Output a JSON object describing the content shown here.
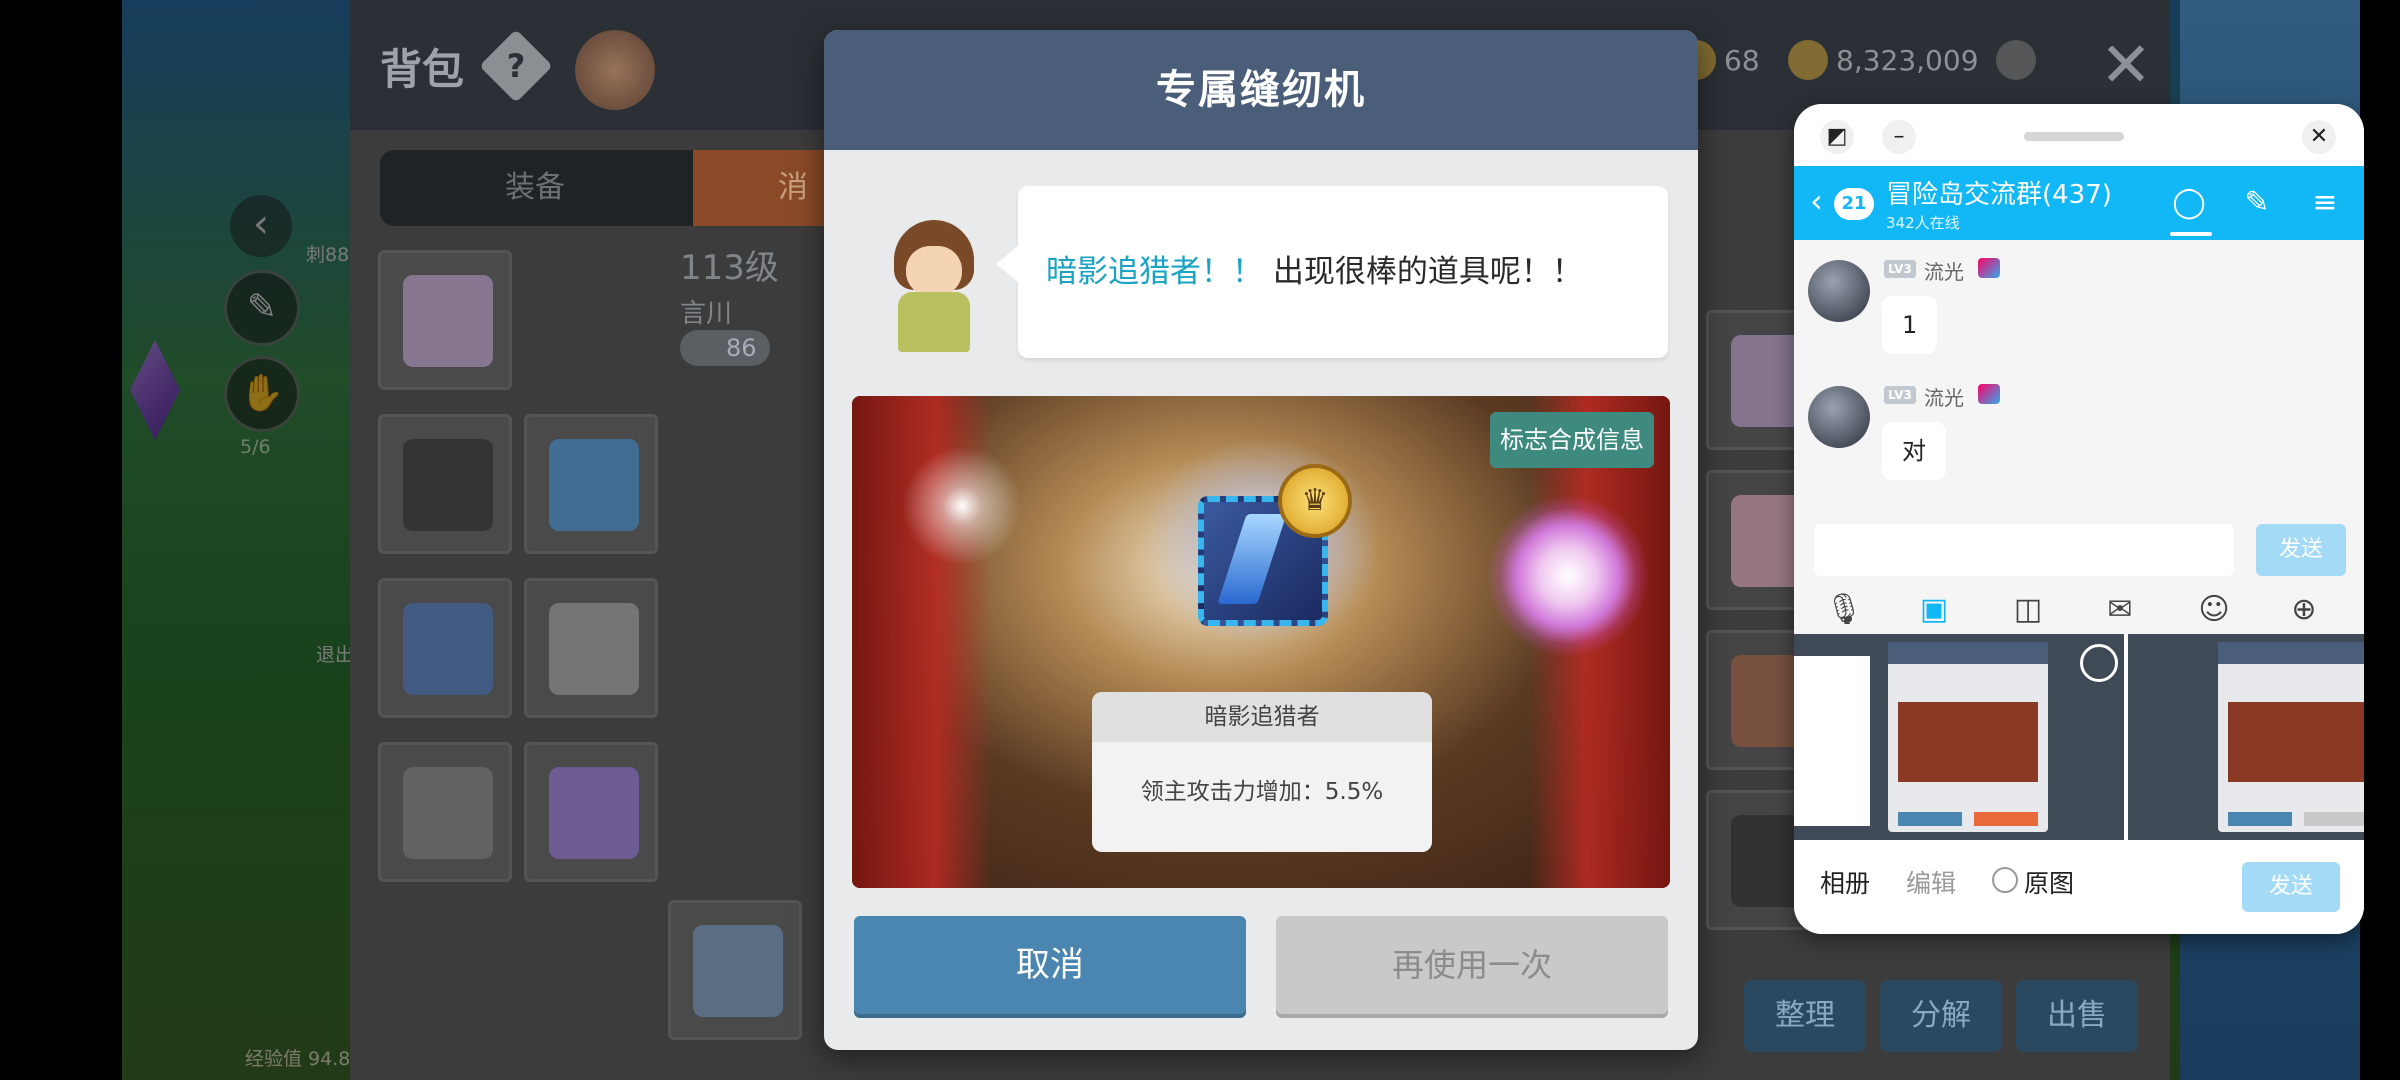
{
  "game": {
    "hud_counter": "5/6",
    "exp_label": "经验值 94.8",
    "side_label_1": "刺88",
    "side_label_2": "退出"
  },
  "inventory": {
    "title": "背包",
    "tabs": [
      "装备",
      "消"
    ],
    "level": "113级",
    "char_name": "言川",
    "badge_value": "86",
    "top_count": "68",
    "top_coins": "8,323,009",
    "buttons": {
      "sort": "整理",
      "disassemble": "分解",
      "sell": "出售"
    }
  },
  "modal": {
    "title": "专属缝纫机",
    "speech_highlight": "暗影追猎者！！",
    "speech_text": "出现很棒的道具呢！！",
    "info_badge": "标志合成信息",
    "item_name": "暗影追猎者",
    "item_desc": "领主攻击力增加：5.5%",
    "cancel_label": "取消",
    "retry_label": "再使用一次"
  },
  "chat": {
    "unread_count": "21",
    "group_name": "冒险岛交流群(437)",
    "online": "342人在线",
    "messages": [
      {
        "level": "LV3",
        "nick": "流光",
        "text": "1"
      },
      {
        "level": "LV3",
        "nick": "流光",
        "text": "对"
      }
    ],
    "send_label": "发送",
    "bottom": {
      "album": "相册",
      "edit": "编辑",
      "original": "原图",
      "send": "发送"
    }
  },
  "icons": {
    "help": "help-icon",
    "close": "close-icon",
    "menu": "menu-icon",
    "voice": "microphone-icon",
    "image": "image-icon",
    "camera": "camera-icon",
    "redpacket": "red-packet-icon",
    "emoji": "emoji-icon",
    "plus": "plus-icon"
  },
  "colors": {
    "modal_header": "#4a5e7a",
    "accent_teal": "#1aa3c2",
    "cancel_button": "#4a86b0",
    "chat_header": "#12b7f5",
    "info_badge": "#3f8a7e"
  }
}
